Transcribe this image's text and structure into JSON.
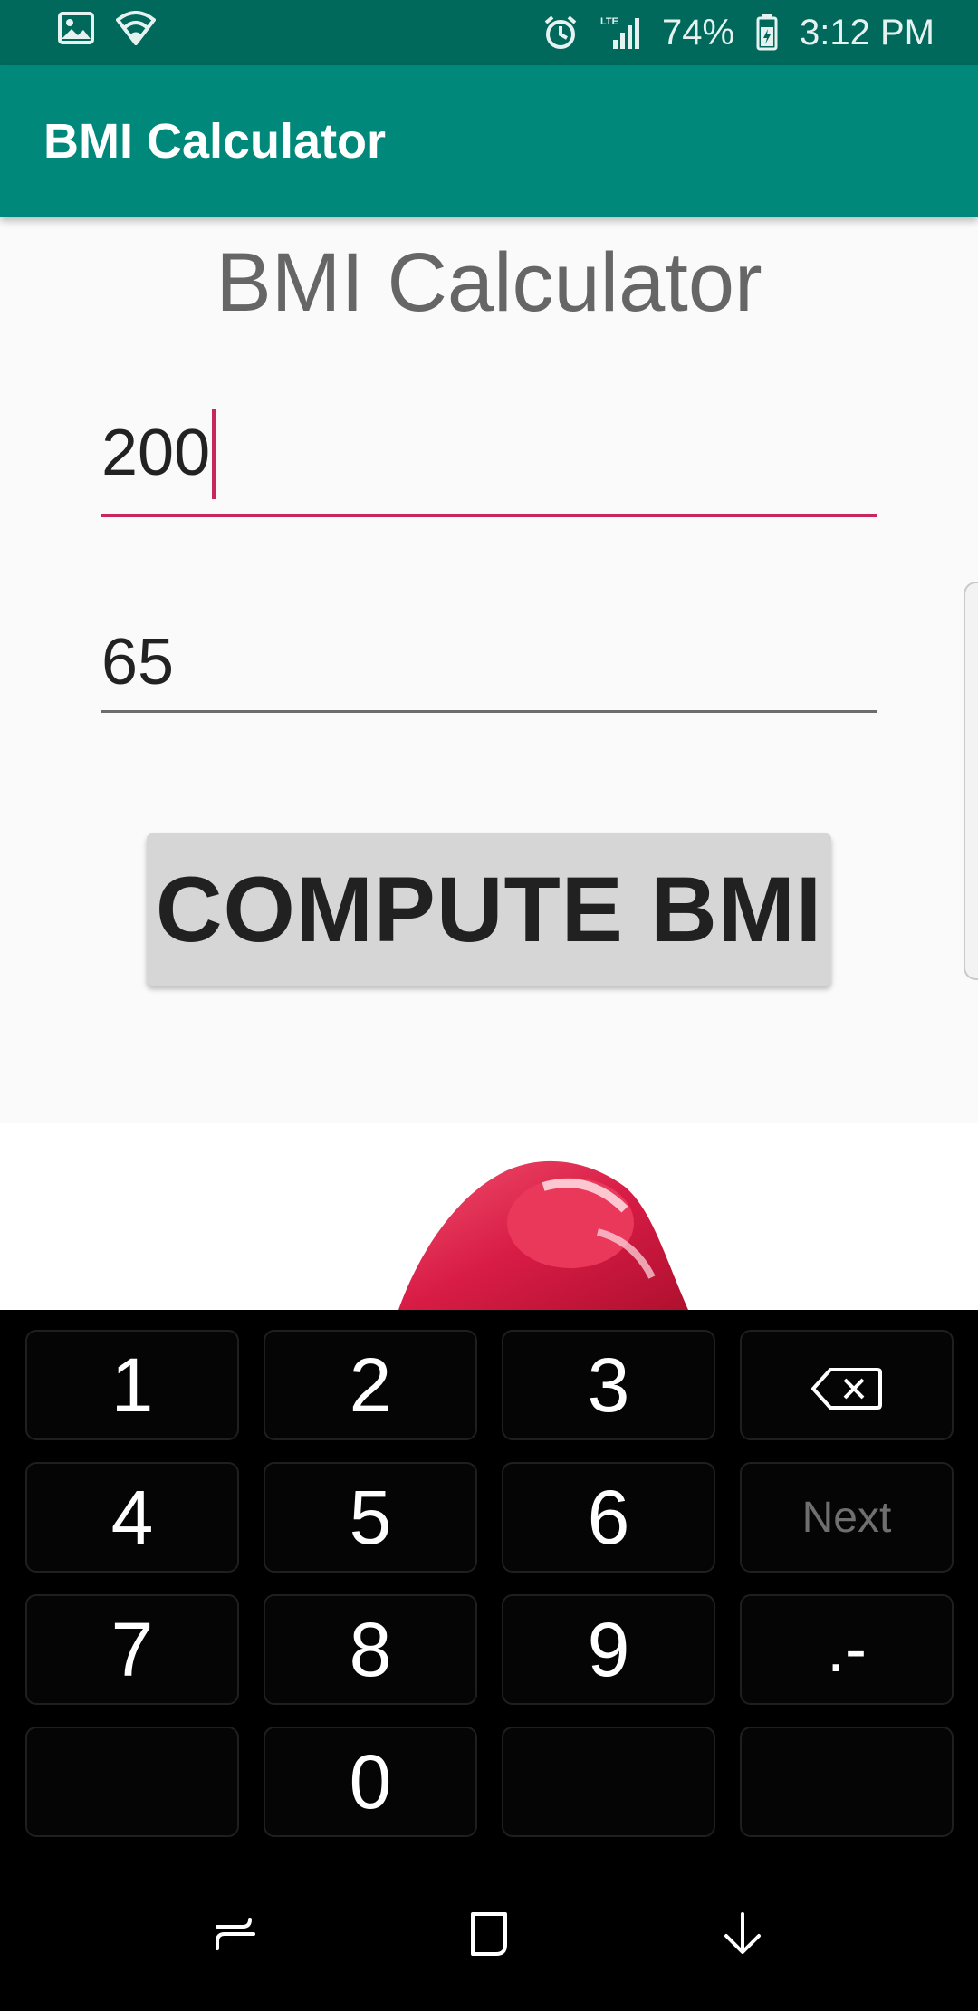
{
  "status_bar": {
    "battery": "74%",
    "time": "3:12 PM",
    "network": "LTE",
    "icons": [
      "gallery-icon",
      "wifi-icon",
      "alarm-icon",
      "signal-icon",
      "battery-icon"
    ]
  },
  "app_bar": {
    "title": "BMI Calculator"
  },
  "main": {
    "heading": "BMI Calculator",
    "height_field": {
      "value": "200",
      "focused": true
    },
    "weight_field": {
      "value": "65"
    },
    "compute_label": "COMPUTE BMI"
  },
  "keyboard": {
    "keys": [
      {
        "label": "1",
        "type": "digit"
      },
      {
        "label": "2",
        "type": "digit"
      },
      {
        "label": "3",
        "type": "digit"
      },
      {
        "label": "",
        "type": "backspace",
        "icon": "backspace-icon"
      },
      {
        "label": "4",
        "type": "digit"
      },
      {
        "label": "5",
        "type": "digit"
      },
      {
        "label": "6",
        "type": "digit"
      },
      {
        "label": "Next",
        "type": "action"
      },
      {
        "label": "7",
        "type": "digit"
      },
      {
        "label": "8",
        "type": "digit"
      },
      {
        "label": "9",
        "type": "digit"
      },
      {
        "label": ".-",
        "type": "symbol"
      },
      {
        "label": "",
        "type": "empty"
      },
      {
        "label": "0",
        "type": "digit"
      },
      {
        "label": "",
        "type": "empty"
      },
      {
        "label": "",
        "type": "empty"
      }
    ]
  },
  "nav_bar": {
    "buttons": [
      "recent-apps-icon",
      "home-icon",
      "hide-keyboard-icon"
    ]
  },
  "colors": {
    "status_bar": "#00695c",
    "app_bar": "#00897b",
    "accent": "#c8265e",
    "button_bg": "#d6d6d6",
    "keyboard_bg": "#000000"
  }
}
